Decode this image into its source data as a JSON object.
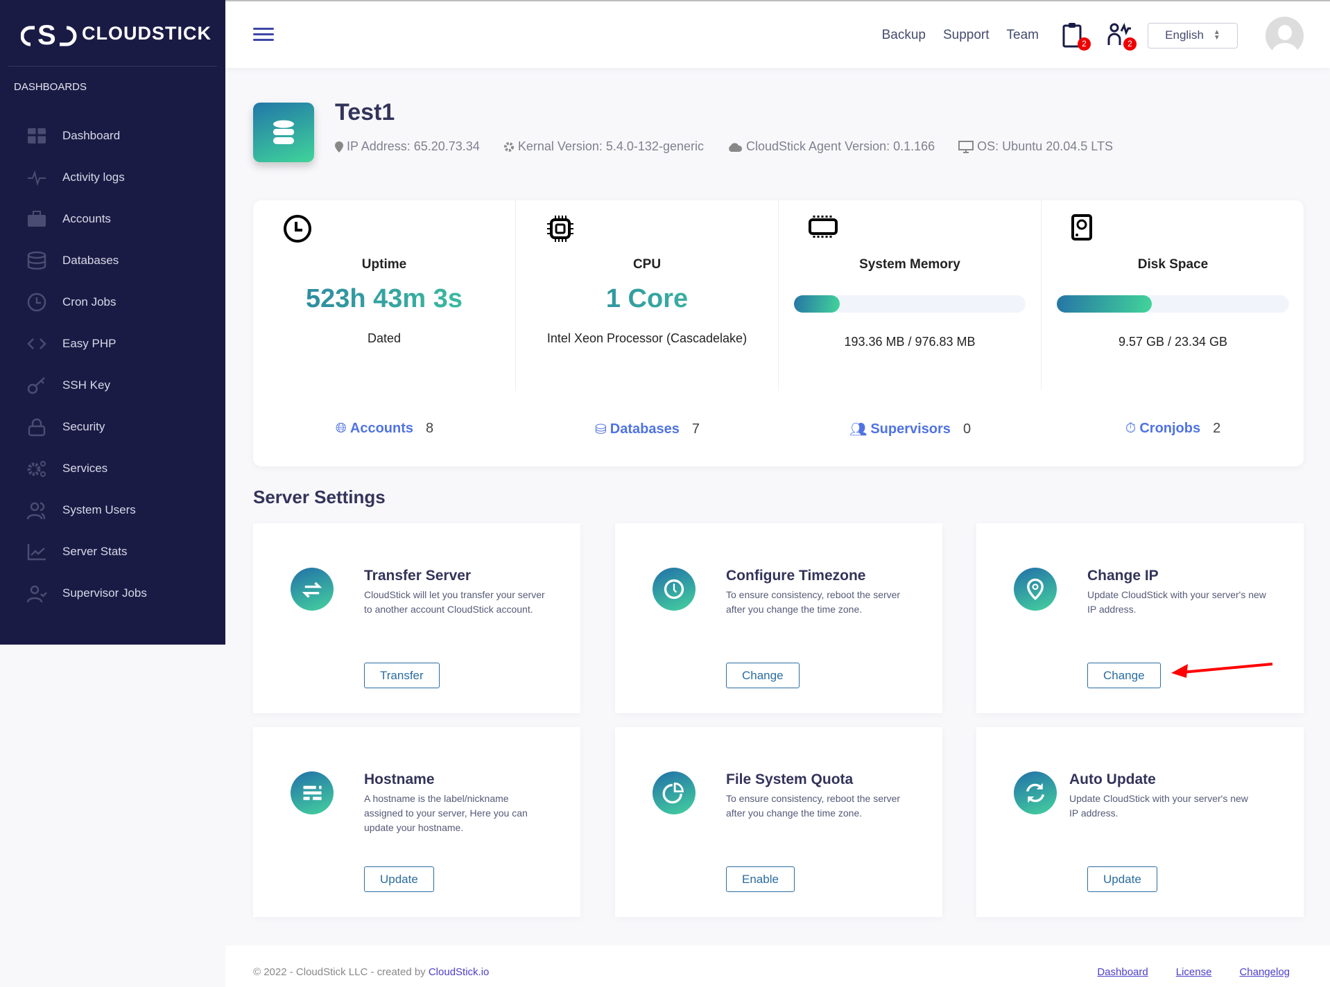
{
  "brand": {
    "name": "CLOUDSTICK"
  },
  "sidebar": {
    "section": "DASHBOARDS",
    "items": [
      {
        "label": "Dashboard",
        "icon": "grid-icon"
      },
      {
        "label": "Activity logs",
        "icon": "pulse-icon"
      },
      {
        "label": "Accounts",
        "icon": "briefcase-icon"
      },
      {
        "label": "Databases",
        "icon": "database-icon"
      },
      {
        "label": "Cron Jobs",
        "icon": "clock-icon"
      },
      {
        "label": "Easy PHP",
        "icon": "code-icon"
      },
      {
        "label": "SSH Key",
        "icon": "key-icon"
      },
      {
        "label": "Security",
        "icon": "lock-icon"
      },
      {
        "label": "Services",
        "icon": "gears-icon"
      },
      {
        "label": "System Users",
        "icon": "users-icon"
      },
      {
        "label": "Server Stats",
        "icon": "chart-icon"
      },
      {
        "label": "Supervisor Jobs",
        "icon": "user-check-icon"
      }
    ]
  },
  "header": {
    "links": [
      "Backup",
      "Support",
      "Team"
    ],
    "tasks_badge": "2",
    "activity_badge": "2",
    "language": "English"
  },
  "server": {
    "name": "Test1",
    "ip": "IP Address: 65.20.73.34",
    "kernel": "Kernal Version: 5.4.0-132-generic",
    "agent": "CloudStick Agent Version: 0.1.166",
    "os": "OS: Ubuntu 20.04.5 LTS"
  },
  "stats": {
    "uptime": {
      "label": "Uptime",
      "value": "523h 43m 3s",
      "sub": "Dated"
    },
    "cpu": {
      "label": "CPU",
      "value": "1 Core",
      "sub": "Intel Xeon Processor (Cascadelake)"
    },
    "memory": {
      "label": "System Memory",
      "value": "193.36 MB / 976.83 MB",
      "percent": 19.8
    },
    "disk": {
      "label": "Disk Space",
      "value": "9.57 GB / 23.34 GB",
      "percent": 41
    }
  },
  "counts": [
    {
      "label": "Accounts",
      "value": "8"
    },
    {
      "label": "Databases",
      "value": "7"
    },
    {
      "label": "Supervisors",
      "value": "0"
    },
    {
      "label": "Cronjobs",
      "value": "2"
    }
  ],
  "settings": {
    "title": "Server Settings",
    "cards": [
      {
        "title": "Transfer Server",
        "desc": "CloudStick will let you transfer your server to another account CloudStick account.",
        "button": "Transfer"
      },
      {
        "title": "Configure Timezone",
        "desc": "To ensure consistency, reboot the server after you change the time zone.",
        "button": "Change"
      },
      {
        "title": "Change IP",
        "desc": "Update CloudStick with your server's new IP address.",
        "button": "Change"
      },
      {
        "title": "Hostname",
        "desc": "A hostname is the label/nickname assigned to your server, Here you can update your hostname.",
        "button": "Update"
      },
      {
        "title": "File System Quota",
        "desc": "To ensure consistency, reboot the server after you change the time zone.",
        "button": "Enable"
      },
      {
        "title": "Auto Update",
        "desc": "Update CloudStick with your server's new IP address.",
        "button": "Update"
      }
    ]
  },
  "footer": {
    "copy": "© 2022 - CloudStick LLC - created by ",
    "copy_link": "CloudStick.io",
    "links": [
      "Dashboard",
      "License",
      "Changelog"
    ]
  },
  "colors": {
    "sidebar": "#1a1b45",
    "accent": "#4f73e3",
    "teal": "#3fc9a0",
    "annotation": "#ff0000"
  }
}
